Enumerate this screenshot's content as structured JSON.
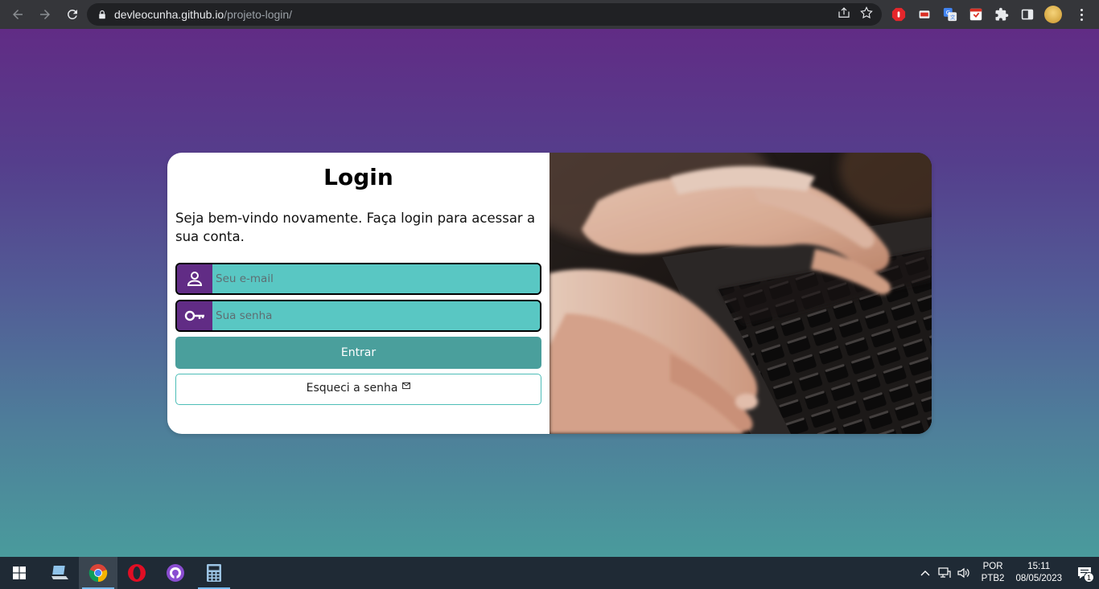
{
  "browser": {
    "url_host": "devleocunha.github.io",
    "url_path": "/projeto-login/"
  },
  "login": {
    "title": "Login",
    "welcome": "Seja bem-vindo novamente. Faça login para acessar a sua conta.",
    "email_placeholder": "Seu e-mail",
    "password_placeholder": "Sua senha",
    "enter_label": "Entrar",
    "forgot_label": "Esqueci a senha",
    "colors": {
      "accent_purple": "#612c85",
      "field_teal": "#59c7c3",
      "button_teal": "#4a9f9c"
    }
  },
  "taskbar": {
    "language_line1": "POR",
    "language_line2": "PTB2",
    "time": "15:11",
    "date": "08/05/2023",
    "notification_count": "1",
    "apps": [
      "file-explorer",
      "chrome",
      "opera",
      "github-desktop",
      "calculator"
    ]
  }
}
